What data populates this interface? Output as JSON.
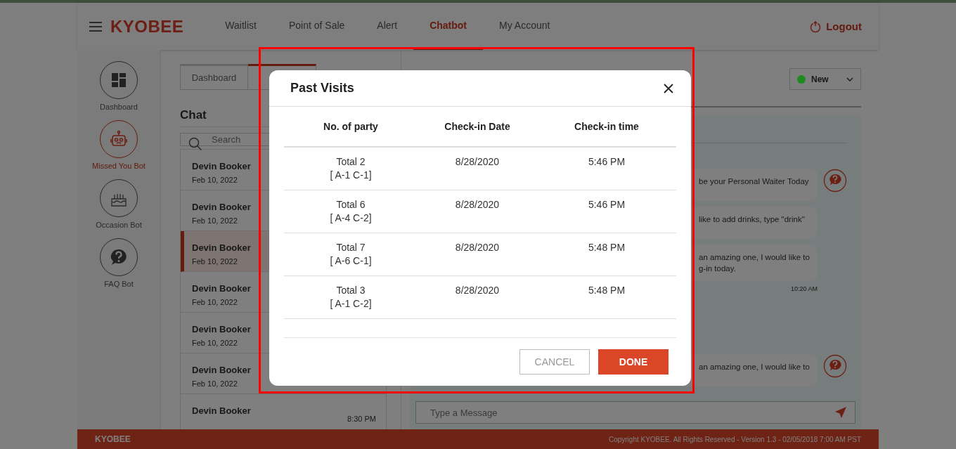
{
  "top_nav": {
    "brand": "KYOBEE",
    "links": [
      {
        "label": "Waitlist",
        "selected": false
      },
      {
        "label": "Point of Sale",
        "selected": false
      },
      {
        "label": "Alert",
        "selected": false
      },
      {
        "label": "Chatbot",
        "selected": true
      },
      {
        "label": "My Account",
        "selected": false
      }
    ],
    "logout": "Logout"
  },
  "bot_rail": [
    {
      "label": "Dashboard",
      "kind": "dashboard",
      "selected": false
    },
    {
      "label": "Missed You Bot",
      "kind": "robot",
      "selected": true
    },
    {
      "label": "Occasion Bot",
      "kind": "cake",
      "selected": false
    },
    {
      "label": "FAQ Bot",
      "kind": "faq",
      "selected": false
    }
  ],
  "chat_list": {
    "tabs": [
      {
        "label": "Dashboard",
        "selected": false
      },
      {
        "selected": true
      }
    ],
    "title": "Chat",
    "search": {
      "placeholder": "Search"
    },
    "items": [
      {
        "name": "Devin Booker",
        "date": "Feb 10, 2022",
        "selected": false
      },
      {
        "name": "Devin Booker",
        "date": "Feb 10, 2022",
        "selected": false
      },
      {
        "name": "Devin Booker",
        "date": "Feb 10, 2022",
        "selected": true
      },
      {
        "name": "Devin Booker",
        "date": "Feb 10, 2022",
        "selected": false
      },
      {
        "name": "Devin Booker",
        "date": "Feb 10, 2022",
        "selected": false
      },
      {
        "name": "Devin Booker",
        "date": "Feb 10, 2022",
        "selected": false
      },
      {
        "name": "Devin Booker",
        "time": "8:30 PM",
        "selected": false
      }
    ]
  },
  "conversation": {
    "status": {
      "label": "New",
      "color": "#1f8a1f"
    },
    "messages": [
      {
        "lines": [
          "be your Personal Waiter Today"
        ],
        "avatar": true
      },
      {
        "lines": [
          "like to add drinks, type \"drink\""
        ],
        "avatar": false
      },
      {
        "lines": [
          "an amazing one, I would like to",
          "g-in today."
        ],
        "avatar": false,
        "time": "10:20 AM"
      },
      {
        "lines": [
          "an amazing one, I would like to"
        ],
        "avatar": true
      }
    ],
    "input": {
      "placeholder": "Type a Message"
    }
  },
  "modal": {
    "title": "Past Visits",
    "columns": [
      "No. of party",
      "Check-in Date",
      "Check-in time"
    ],
    "rows": [
      {
        "party": "Total 2",
        "breakdown": "[ A-1 C-1]",
        "date": "8/28/2020",
        "time": "5:46 PM"
      },
      {
        "party": "Total 6",
        "breakdown": "[ A-4 C-2]",
        "date": "8/28/2020",
        "time": "5:46 PM"
      },
      {
        "party": "Total 7",
        "breakdown": "[ A-6 C-1]",
        "date": "8/28/2020",
        "time": "5:48 PM"
      },
      {
        "party": "Total 3",
        "breakdown": "[ A-1 C-2]",
        "date": "8/28/2020",
        "time": "5:48 PM"
      }
    ],
    "buttons": [
      {
        "label": "CANCEL",
        "kind": "secondary"
      },
      {
        "label": "DONE",
        "kind": "primary"
      }
    ]
  },
  "footer": {
    "brand": "KYOBEE",
    "copyright": "Copyright KYOBEE. All Rights Reserved - Version 1.3 - 02/05/2018 7:00 AM PST"
  }
}
